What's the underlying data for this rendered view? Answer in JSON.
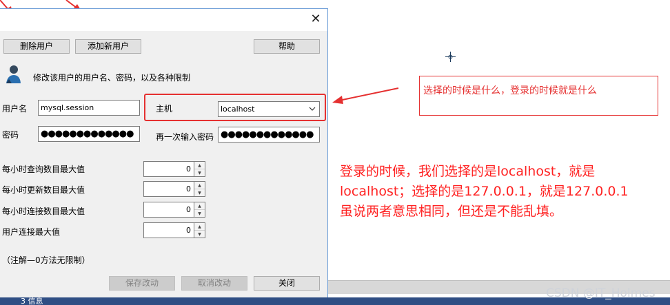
{
  "dialog": {
    "close_glyph": "✕",
    "buttons": {
      "delete_user": "删除用户",
      "add_new_user": "添加新用户",
      "help": "帮助"
    },
    "description": "修改该用户的用户名、密码，以及各种限制",
    "fields": {
      "username_label": "用户名",
      "username_value": "mysql.session",
      "host_label": "主机",
      "host_value": "localhost",
      "password_label": "密码",
      "password_value": "●●●●●●●●●●●●●",
      "confirm_password_label": "再一次输入密码",
      "confirm_password_value": "●●●●●●●●●●●●●"
    },
    "limits": [
      {
        "label": "每小时查询数目最大值",
        "value": "0"
      },
      {
        "label": "每小时更新数目最大值",
        "value": "0"
      },
      {
        "label": "每小时连接数目最大值",
        "value": "0"
      },
      {
        "label": "用户连接最大值",
        "value": "0"
      }
    ],
    "note": "（注解—0方法无限制）",
    "footer_buttons": {
      "save": "保存改动",
      "cancel": "取消改动",
      "close": "关闭"
    }
  },
  "annotations": {
    "box_text": "选择的时候是什么，登录的时候就是什么",
    "main_lines": [
      "登录的时候，我们选择的是localhost，就是",
      "localhost；选择的是127.0.0.1，就是127.0.0.1",
      "虽说两者意思相同，但还是不能乱填。"
    ],
    "accent_color": "#e53030"
  },
  "taskbar": {
    "item": "3 信息"
  },
  "watermark": "CSDN @IT_Holmes"
}
